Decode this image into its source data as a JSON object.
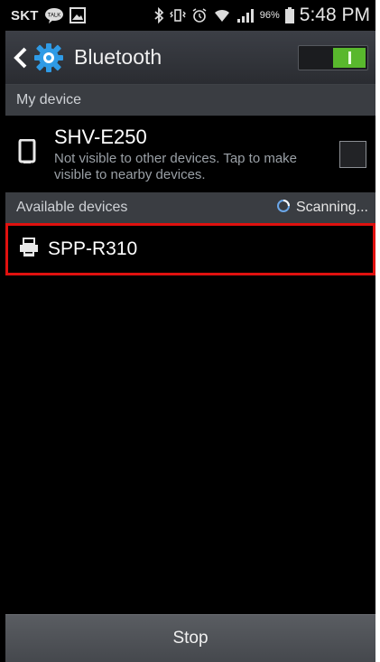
{
  "status_bar": {
    "carrier": "SKT",
    "battery_percent": "96%",
    "time": "5:48 PM",
    "icons": [
      "talk-icon",
      "image-icon",
      "bluetooth-icon",
      "vibrate-icon",
      "alarm-icon",
      "wifi-icon",
      "signal-icon",
      "battery-icon"
    ]
  },
  "action_bar": {
    "title": "Bluetooth",
    "toggle_on": true,
    "accent": "#59b82d"
  },
  "my_device": {
    "header": "My device",
    "name": "SHV-E250",
    "subtitle": "Not visible to other devices. Tap to make visible to nearby devices.",
    "checked": false
  },
  "available": {
    "header": "Available devices",
    "scan_status": "Scanning...",
    "devices": [
      {
        "name": "SPP-R310",
        "icon": "printer-icon"
      }
    ],
    "highlight_color": "#e0110f"
  },
  "bottom": {
    "stop_label": "Stop"
  }
}
